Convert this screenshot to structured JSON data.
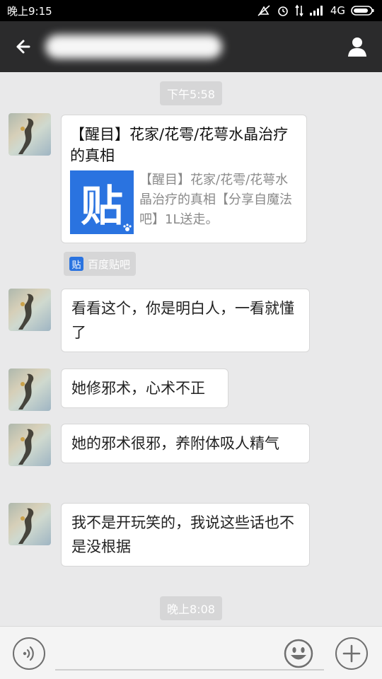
{
  "status_bar": {
    "time": "晚上9:15",
    "network": "4G"
  },
  "header": {
    "back_icon": "arrow-left-icon",
    "profile_icon": "user-icon"
  },
  "chat": {
    "time_1": "下午5:58",
    "share_card": {
      "title": "【醒目】花家/花雩/花萼水晶治疗的真相",
      "thumb_text": "贴",
      "description": "【醒目】花家/花雩/花萼水晶治疗的真相【分享自魔法吧】1L送走。"
    },
    "source_tag": {
      "logo_text": "贴",
      "label": "百度贴吧"
    },
    "messages": [
      "看看这个，你是明白人，一看就懂了",
      "她修邪术，心术不正",
      "她的邪术很邪，养附体吸人精气",
      "我不是开玩笑的，我说这些话也不是没根据"
    ],
    "time_2": "晚上8:08"
  },
  "input_bar": {
    "voice_icon": "voice-icon",
    "emoji_icon": "smiley-icon",
    "plus_icon": "plus-icon"
  }
}
